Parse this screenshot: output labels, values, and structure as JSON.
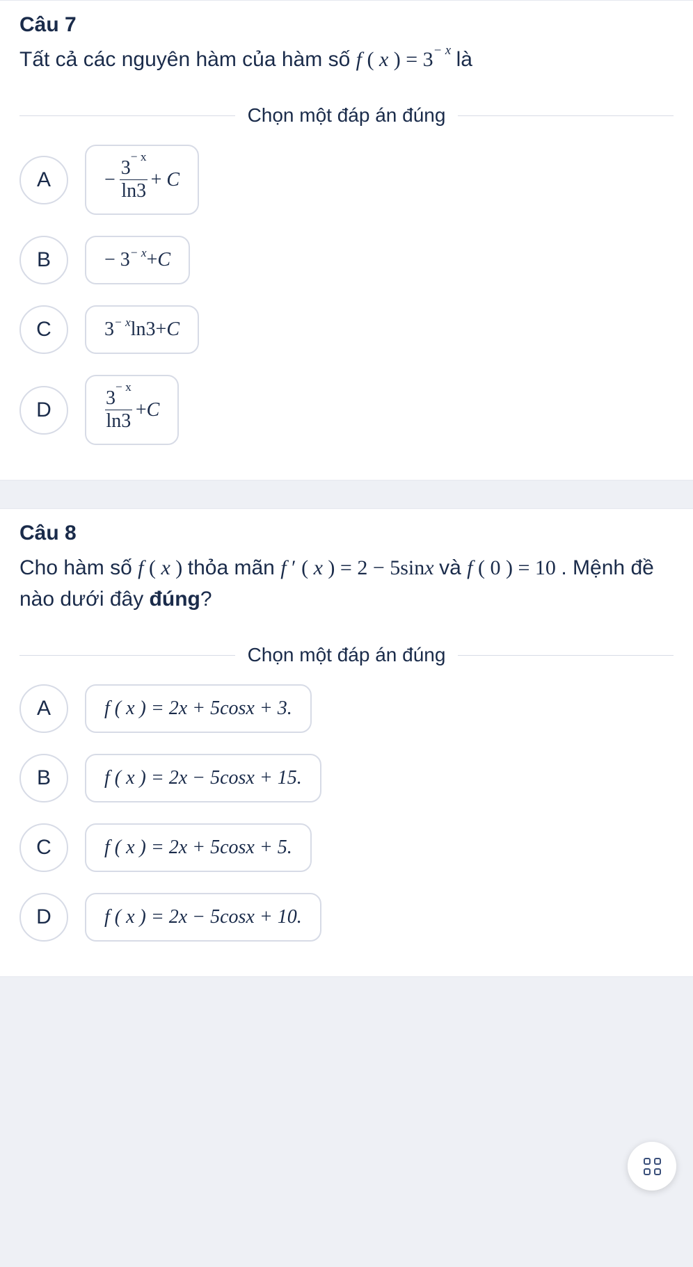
{
  "q7": {
    "title": "Câu 7",
    "text_pre": "Tất cả các nguyên hàm của hàm số ",
    "text_post": " là",
    "divider": "Chọn một đáp án đúng",
    "letters": {
      "a": "A",
      "b": "B",
      "c": "C",
      "d": "D"
    },
    "opts": {
      "a_exp": "− x",
      "a_den": "ln3",
      "a_plusC": " + C",
      "b_main": "− 3",
      "b_exp": "− x",
      "b_plusC": " + C",
      "c_main": "3",
      "c_exp": "− x",
      "c_ln": "ln3",
      "c_plusC": " + C",
      "d_exp": "− x",
      "d_den": "ln3",
      "d_plusC": " + C"
    },
    "fx": {
      "f": "f",
      "open": " ( ",
      "x": "x",
      "close": " ) ",
      "eq": " = 3",
      "exp": " − x"
    }
  },
  "q8": {
    "title": "Câu 8",
    "text_pre": "Cho hàm số ",
    "text_mid1": " thỏa mãn ",
    "text_mid2": " và ",
    "text_mid3": ". Mệnh đề nào dưới đây ",
    "text_bold": "đúng",
    "text_qm": "?",
    "divider": "Chọn một đáp án đúng",
    "fx": {
      "f": "f",
      "open": " ( ",
      "x": "x",
      "close": " ) "
    },
    "fprime": {
      "f": "f",
      "prime": " ′ ",
      "open": "( ",
      "x": "x",
      "close": " ) ",
      "rhs": " = 2 − 5sin",
      "xrhs": "x"
    },
    "f0": {
      "f": "f",
      "open": " ( 0 ) ",
      "rhs": " = 10"
    },
    "letters": {
      "a": "A",
      "b": "B",
      "c": "C",
      "d": "D"
    },
    "opts": {
      "a": "f ( x ) = 2x + 5cosx + 3.",
      "b": "f ( x ) = 2x − 5cosx + 15.",
      "c": "f ( x ) = 2x + 5cosx + 5.",
      "d": "f ( x ) = 2x − 5cosx + 10."
    }
  }
}
